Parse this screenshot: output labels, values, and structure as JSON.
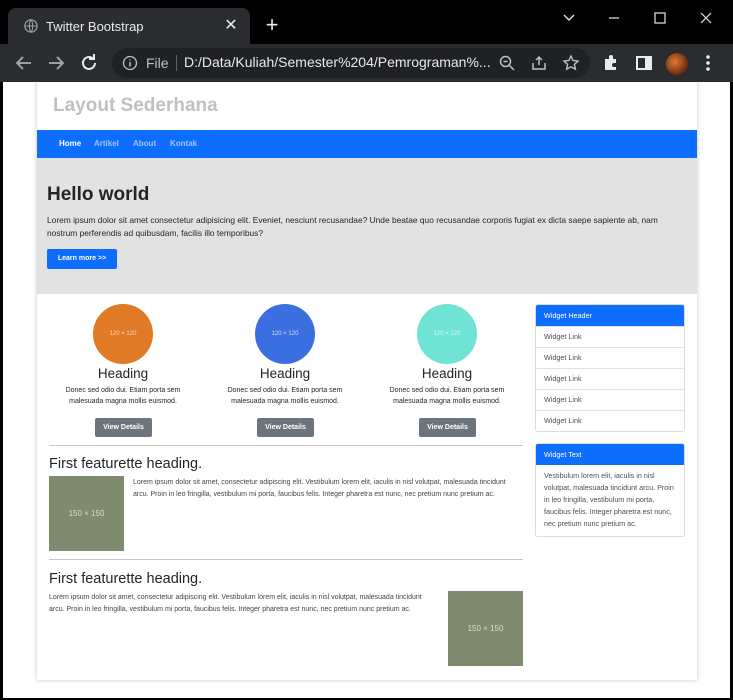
{
  "browser": {
    "tab_title": "Twitter Bootstrap",
    "url_scheme": "File",
    "url": "D:/Data/Kuliah/Semester%204/Pemrograman%..."
  },
  "site": {
    "title": "Layout Sederhana",
    "nav": [
      {
        "label": "Home",
        "active": true
      },
      {
        "label": "Artikel",
        "active": false
      },
      {
        "label": "About",
        "active": false
      },
      {
        "label": "Kontak",
        "active": false
      }
    ]
  },
  "jumbotron": {
    "title": "Hello world",
    "text": "Lorem ipsum dolor sit amet consectetur adipisicing elit. Eveniet, nesciunt recusandae? Unde beatae quo recusandae corporis fugiat ex dicta saepe sapiente ab, nam nostrum perferendis ad quibusdam, facilis illo temporibus?",
    "button": "Learn more >>"
  },
  "cards": [
    {
      "image_label": "120 × 120",
      "color": "#e07a26",
      "heading": "Heading",
      "text": "Donec sed odio dui. Etiam porta sem malesuada magna mollis euismod.",
      "button": "View Details"
    },
    {
      "image_label": "120 × 120",
      "color": "#3b6fe0",
      "heading": "Heading",
      "text": "Donec sed odio dui. Etiam porta sem malesuada magna mollis euismod.",
      "button": "View Details"
    },
    {
      "image_label": "120 × 120",
      "color": "#6fe4d4",
      "heading": "Heading",
      "text": "Donec sed odio dui. Etiam porta sem malesuada magna mollis euismod.",
      "button": "View Details"
    }
  ],
  "featurettes": [
    {
      "heading": "First featurette heading.",
      "text": "Lorem ipsum dolor sit amet, consectetur adipiscing elit. Vestibulum lorem elit, iaculis in nisl volutpat, malesuada tincidunt arcu. Proin in leo fringilla, vestibulum mi porta, faucibus felis. Integer pharetra est nunc, nec pretium nunc pretium ac.",
      "image_label": "150 × 150"
    },
    {
      "heading": "First featurette heading.",
      "text": "Lorem ipsum dolor sit amet, consectetur adipiscing elit. Vestibulum lorem elit, iaculis in nisl volutpat, malesuada tincidunt arcu. Proin in leo fringilla, vestibulum mi porta, faucibus felis. Integer pharetra est nunc, nec pretium nunc pretium ac.",
      "image_label": "150 × 150"
    }
  ],
  "widgets": {
    "header": "Widget Header",
    "links": [
      "Widget Link",
      "Widget Link",
      "Widget Link",
      "Widget Link",
      "Widget Link"
    ],
    "text_header": "Widget Text",
    "text": "Vestibulum lorem elit, iaculis in nisl volutpat, malesuada tincidunt arcu. Proin in leo fringilla, vestibulum mi porta, faucibus felis. Integer pharetra est nunc, nec pretium nunc pretium ac."
  },
  "colors": {
    "primary": "#0d6efd",
    "secondary": "#6c757d",
    "jumbotron_bg": "#e2e2e2",
    "placeholder_img": "#7e8b6f"
  }
}
